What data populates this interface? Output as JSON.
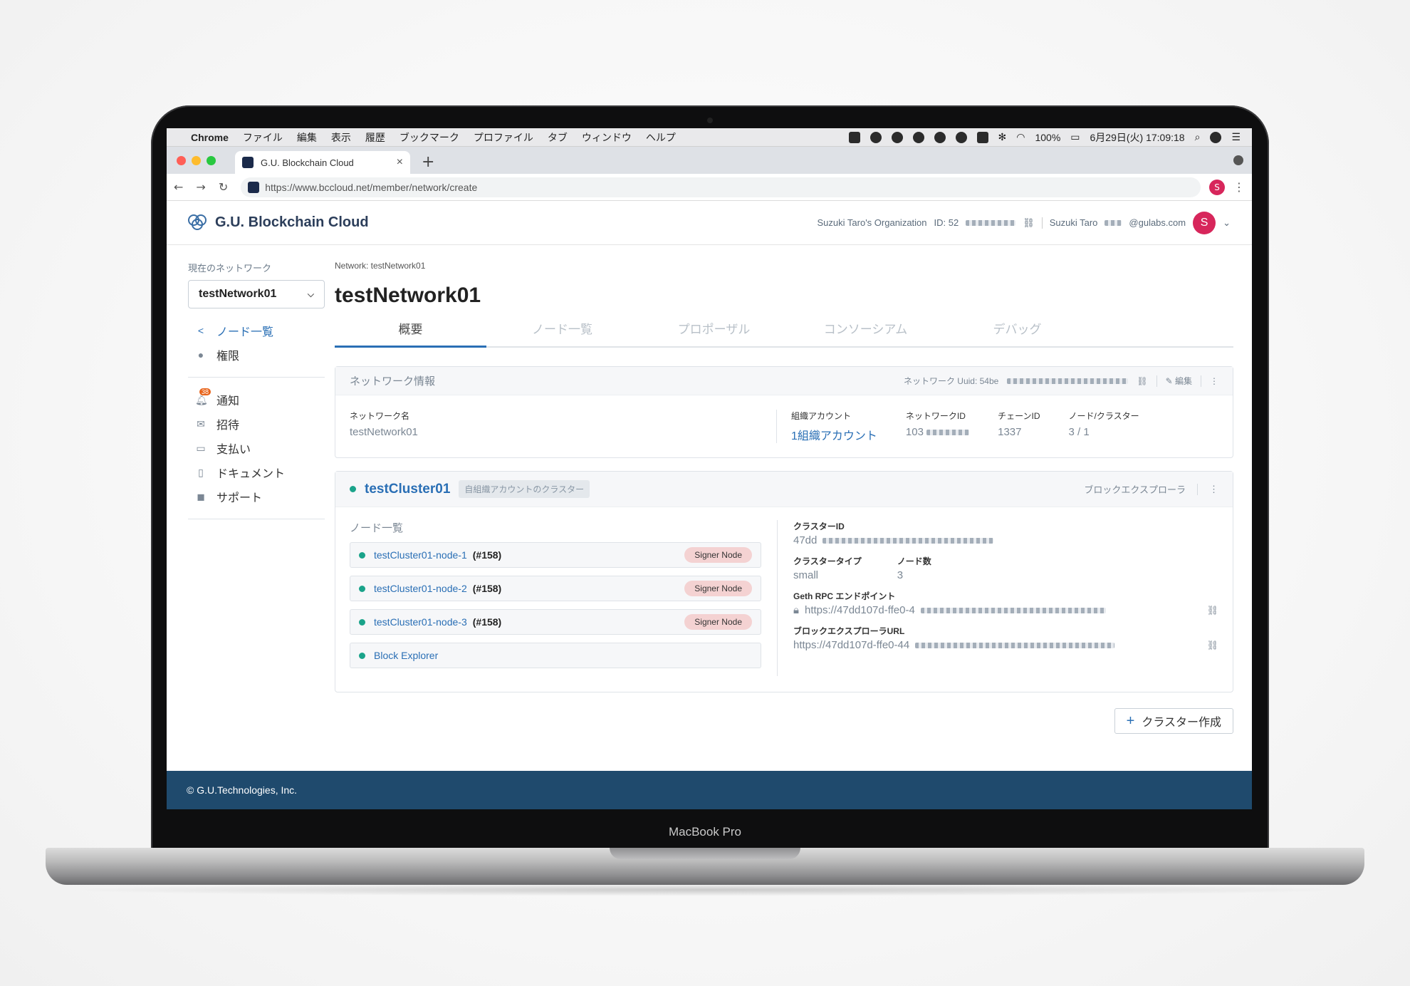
{
  "device_label": "MacBook Pro",
  "menubar": {
    "apple": "",
    "items": [
      "Chrome",
      "ファイル",
      "編集",
      "表示",
      "履歴",
      "ブックマーク",
      "プロファイル",
      "タブ",
      "ウィンドウ",
      "ヘルプ"
    ],
    "battery": "100%",
    "datetime": "6月29日(火) 17:09:18"
  },
  "browser": {
    "tab_title": "G.U. Blockchain Cloud",
    "url": "https://www.bccloud.net/member/network/create",
    "profile_initial": "S"
  },
  "header": {
    "logo_text": "G.U. Blockchain Cloud",
    "org": "Suzuki Taro's Organization",
    "org_id_label": "ID: 52",
    "user_name": "Suzuki Taro",
    "user_email_suffix": "@gulabs.com",
    "avatar_initial": "S"
  },
  "sidebar": {
    "current_network_label": "現在のネットワーク",
    "network_selected": "testNetwork01",
    "primary": [
      {
        "label": "ノード一覧",
        "icon": "share-icon",
        "active": true
      },
      {
        "label": "権限",
        "icon": "user-icon",
        "active": false
      }
    ],
    "notification_count": "38",
    "secondary": [
      {
        "label": "通知",
        "icon": "bell-icon"
      },
      {
        "label": "招待",
        "icon": "mail-icon"
      },
      {
        "label": "支払い",
        "icon": "credit-card-icon"
      },
      {
        "label": "ドキュメント",
        "icon": "document-icon"
      },
      {
        "label": "サポート",
        "icon": "chat-icon"
      }
    ]
  },
  "page": {
    "breadcrumb": "Network: testNetwork01",
    "title": "testNetwork01",
    "tabs": [
      "概要",
      "ノード一覧",
      "プロポーザル",
      "コンソーシアム",
      "デバッグ"
    ],
    "active_tab": 0
  },
  "network_card": {
    "title": "ネットワーク情報",
    "uuid_label": "ネットワーク Uuid: 54be",
    "edit_label": "編集",
    "name_label": "ネットワーク名",
    "name_value": "testNetwork01",
    "org_accounts_label": "組織アカウント",
    "org_accounts_value": "1組織アカウント",
    "network_id_label": "ネットワークID",
    "network_id_value": "103",
    "chain_id_label": "チェーンID",
    "chain_id_value": "1337",
    "node_cluster_label": "ノード/クラスター",
    "node_cluster_value": "3 / 1"
  },
  "cluster": {
    "name": "testCluster01",
    "tag": "自組織アカウントのクラスター",
    "explorer_label": "ブロックエクスプローラ",
    "nodes_title": "ノード一覧",
    "nodes": [
      {
        "name": "testCluster01-node-1",
        "number": "(#158)",
        "role": "Signer Node"
      },
      {
        "name": "testCluster01-node-2",
        "number": "(#158)",
        "role": "Signer Node"
      },
      {
        "name": "testCluster01-node-3",
        "number": "(#158)",
        "role": "Signer Node"
      },
      {
        "name": "Block Explorer",
        "number": "",
        "role": ""
      }
    ],
    "cluster_id_label": "クラスターID",
    "cluster_id_value": "47dd",
    "cluster_type_label": "クラスタータイプ",
    "cluster_type_value": "small",
    "node_count_label": "ノード数",
    "node_count_value": "3",
    "rpc_label": "Geth RPC エンドポイント",
    "rpc_value": "https://47dd107d-ffe0-4",
    "explorer_url_label": "ブロックエクスプローラURL",
    "explorer_url_value": "https://47dd107d-ffe0-44"
  },
  "create_cluster_label": "クラスター作成",
  "footer": "© G.U.Technologies, Inc.",
  "colors": {
    "accent": "#2a6fb5",
    "footer": "#1f4a6d",
    "status_green": "#1aa38a",
    "avatar": "#d7265b"
  }
}
